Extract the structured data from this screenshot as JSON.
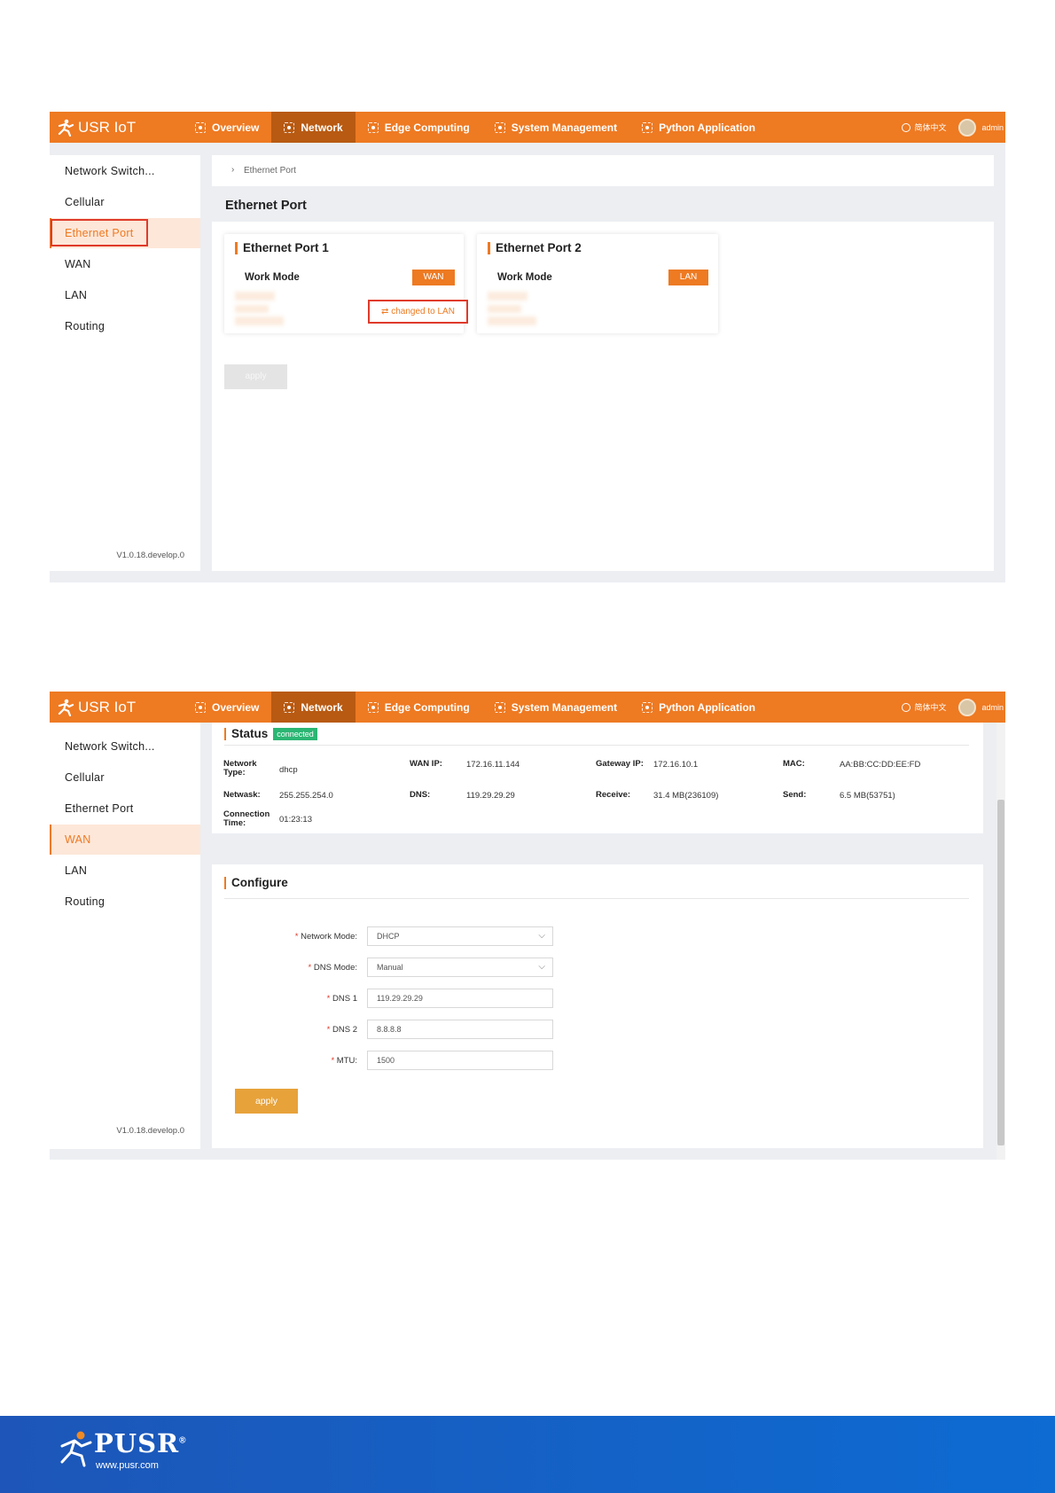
{
  "app": {
    "logo_text": "USR IoT",
    "nav": [
      "Overview",
      "Network",
      "Edge Computing",
      "System Management",
      "Python Application"
    ],
    "active_nav": "Network",
    "language": "简体中文",
    "user": "admin",
    "accent_color": "#ee7a22"
  },
  "sidebar": {
    "items": [
      "Network Switch...",
      "Cellular",
      "Ethernet Port",
      "WAN",
      "LAN",
      "Routing"
    ],
    "version": "V1.0.18.develop.0"
  },
  "ethernet_page": {
    "breadcrumb": "Ethernet Port",
    "title": "Ethernet Port",
    "port1": {
      "title": "Ethernet Port 1",
      "label": "Work Mode",
      "mode": "WAN",
      "switch_label": "⇄ changed to LAN"
    },
    "port2": {
      "title": "Ethernet Port 2",
      "label": "Work Mode",
      "mode": "LAN"
    },
    "apply_label": "apply"
  },
  "wan_page": {
    "status_title": "Status",
    "status_badge": "connected",
    "status": {
      "network_type_label": "Network Type:",
      "network_type": "dhcp",
      "wan_ip_label": "WAN IP:",
      "wan_ip": "172.16.11.144",
      "gateway_label": "Gateway IP:",
      "gateway": "172.16.10.1",
      "mac_label": "MAC:",
      "mac": "AA:BB:CC:DD:EE:FD",
      "netmask_label": "Netwask:",
      "netmask": "255.255.254.0",
      "dns_label": "DNS:",
      "dns": "119.29.29.29",
      "receive_label": "Receive:",
      "receive": "31.4 MB(236109)",
      "send_label": "Send:",
      "send": "6.5 MB(53751)",
      "conn_time_label": "Connection Time:",
      "conn_time": "01:23:13"
    },
    "configure_title": "Configure",
    "form": {
      "network_mode_label": "Network Mode:",
      "network_mode": "DHCP",
      "dns_mode_label": "DNS Mode:",
      "dns_mode": "Manual",
      "dns1_label": "DNS 1",
      "dns1": "119.29.29.29",
      "dns2_label": "DNS 2",
      "dns2": "8.8.8.8",
      "mtu_label": "MTU:",
      "mtu": "1500",
      "required_mark": "*"
    },
    "apply_label": "apply"
  },
  "footer": {
    "brand": "PUSR",
    "registered": "®",
    "url": "www.pusr.com"
  }
}
